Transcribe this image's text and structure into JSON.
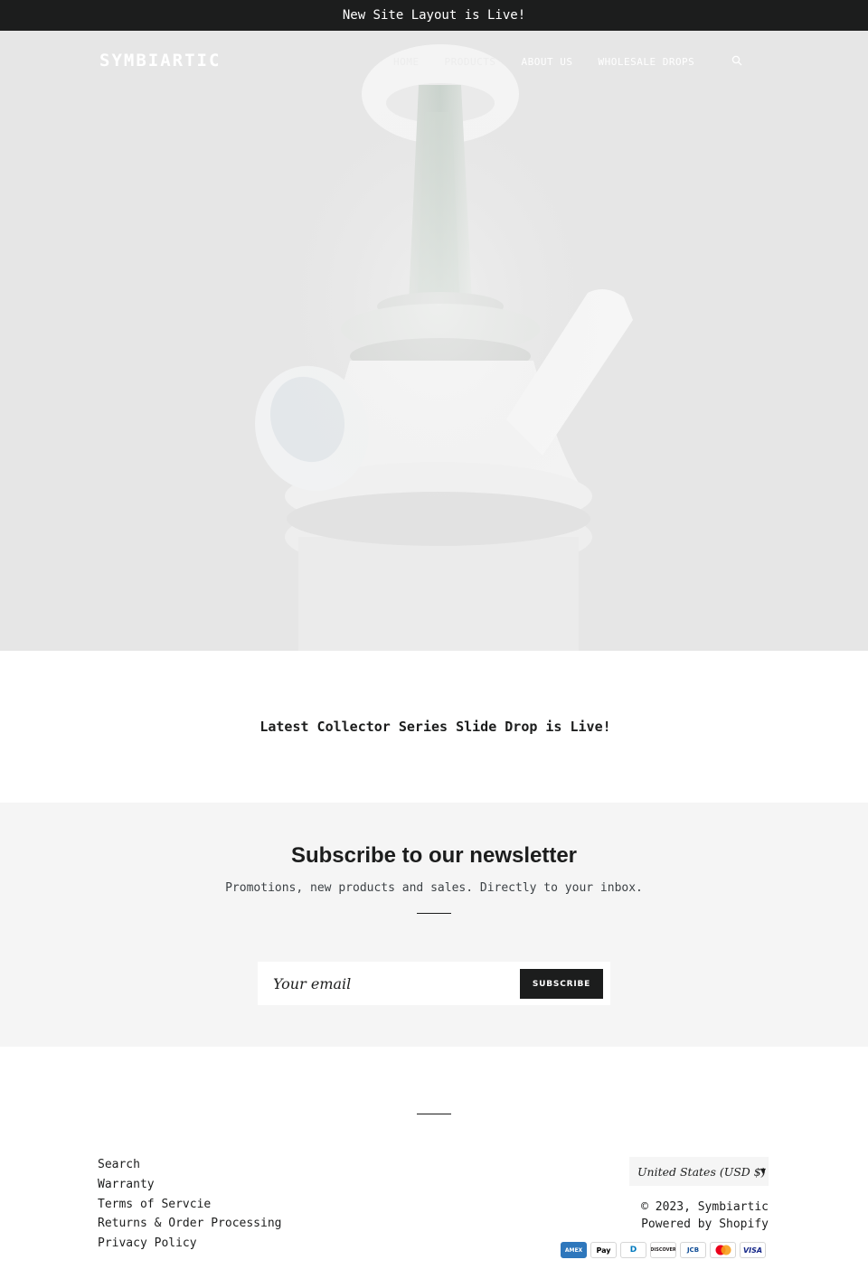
{
  "announcement": {
    "text": "New Site Layout is Live!"
  },
  "header": {
    "logo": "SYMBIARTIC",
    "nav": [
      {
        "label": "HOME"
      },
      {
        "label": "PRODUCTS"
      },
      {
        "label": "ABOUT US"
      },
      {
        "label": "WHOLESALE DROPS"
      }
    ],
    "search_icon": "search-icon"
  },
  "slideshow": {
    "slides": 3,
    "active_slide": 1
  },
  "promo": {
    "text": "Latest Collector Series Slide Drop is Live!"
  },
  "newsletter": {
    "title": "Subscribe to our newsletter",
    "subtitle": "Promotions, new products and sales. Directly to your inbox.",
    "email_placeholder": "Your email",
    "button_label": "SUBSCRIBE"
  },
  "footer": {
    "links": [
      {
        "label": "Search"
      },
      {
        "label": "Warranty"
      },
      {
        "label": "Terms of Servcie"
      },
      {
        "label": "Returns & Order Processing"
      },
      {
        "label": "Privacy Policy"
      }
    ],
    "currency": "United States (USD $)",
    "copyright": "© 2023, Symbiartic",
    "powered_by": "Powered by Shopify",
    "payment_icons": [
      {
        "name": "amex-icon",
        "label": "AMEX",
        "color": "#2e77bc",
        "text_color": "#ffffff"
      },
      {
        "name": "apple-pay-icon",
        "label": "Pay",
        "color": "#ffffff",
        "text_color": "#000000"
      },
      {
        "name": "diners-club-icon",
        "label": "D",
        "color": "#ffffff",
        "text_color": "#0079be"
      },
      {
        "name": "discover-icon",
        "label": "DISCOVER",
        "color": "#ffffff",
        "text_color": "#231f20"
      },
      {
        "name": "jcb-icon",
        "label": "JCB",
        "color": "#ffffff",
        "text_color": "#0e4c96"
      },
      {
        "name": "mastercard-icon",
        "label": "",
        "color": "#ffffff",
        "text_color": "#000000"
      },
      {
        "name": "visa-icon",
        "label": "VISA",
        "color": "#ffffff",
        "text_color": "#142688"
      }
    ]
  },
  "colors": {
    "dark": "#1c1d1d",
    "hero_background": "#e6e6e6",
    "newsletter_background": "#f5f5f5"
  }
}
